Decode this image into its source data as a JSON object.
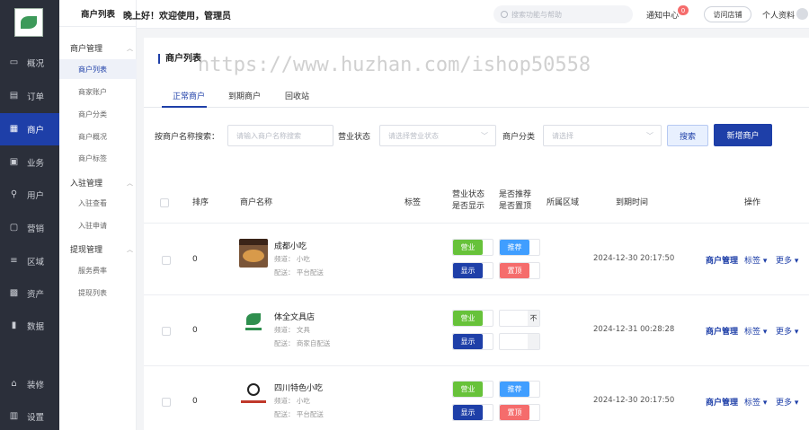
{
  "nav": {
    "items": [
      {
        "label": "概况",
        "icon": "overview-icon"
      },
      {
        "label": "订单",
        "icon": "order-icon"
      },
      {
        "label": "商户",
        "icon": "merchant-icon"
      },
      {
        "label": "业务",
        "icon": "business-icon"
      },
      {
        "label": "用户",
        "icon": "user-icon"
      },
      {
        "label": "营销",
        "icon": "marketing-icon"
      },
      {
        "label": "区域",
        "icon": "region-icon"
      },
      {
        "label": "资产",
        "icon": "asset-icon"
      },
      {
        "label": "数据",
        "icon": "data-icon"
      },
      {
        "label": "装修",
        "icon": "decoration-icon"
      },
      {
        "label": "设置",
        "icon": "settings-icon"
      }
    ]
  },
  "submenu": {
    "title": "商户列表",
    "groups": [
      {
        "label": "商户管理",
        "items": [
          "商户列表",
          "商家账户",
          "商户分类",
          "商户概况",
          "商户标签"
        ]
      },
      {
        "label": "入驻管理",
        "items": [
          "入驻查看",
          "入驻申请"
        ]
      },
      {
        "label": "提现管理",
        "items": [
          "服务费率",
          "提现列表"
        ]
      }
    ]
  },
  "header": {
    "greeting": "晚上好！欢迎使用，管理员",
    "search_placeholder": "搜索功能与帮助",
    "notice": "通知中心",
    "notice_count": "0",
    "visit": "访问店铺",
    "profile": "个人资料"
  },
  "page": {
    "title": "商户列表",
    "watermark": "https://www.huzhan.com/ishop50558",
    "tabs": [
      "正常商户",
      "到期商户",
      "回收站"
    ]
  },
  "filters": {
    "name_label": "按商户名称搜索：",
    "name_placeholder": "请输入商户名称搜索",
    "status_label": "营业状态",
    "status_placeholder": "请选择营业状态",
    "category_label": "商户分类",
    "category_placeholder": "请选择",
    "search_btn": "搜索",
    "add_btn": "新增商户"
  },
  "table": {
    "headers": {
      "sort": "排序",
      "name": "商户名称",
      "tag": "标签",
      "status1": "营业状态",
      "status2": "是否显示",
      "rec1": "是否推荐",
      "rec2": "是否置顶",
      "region": "所属区域",
      "expire": "到期时间",
      "ops": "操作"
    },
    "rows": [
      {
        "sort": "0",
        "name": "成都小吃",
        "channel": "频道：  小吃",
        "delivery": "配送：  平台配送",
        "open": "营业",
        "show": "显示",
        "recommend": "推荐",
        "top": "置顶",
        "rec_on": true,
        "expire": "2024-12-30 20:17:50",
        "thumb": "food-thumbnail"
      },
      {
        "sort": "0",
        "name": "体全文具店",
        "channel": "频道：  文具",
        "delivery": "配送：  商家自配送",
        "open": "营业",
        "show": "显示",
        "recommend": "不",
        "top": "",
        "rec_on": false,
        "expire": "2024-12-31 00:28:28",
        "thumb": "logo-thumbnail"
      },
      {
        "sort": "0",
        "name": "四川特色小吃",
        "channel": "频道：  小吃",
        "delivery": "配送：  平台配送",
        "open": "营业",
        "show": "显示",
        "recommend": "推荐",
        "top": "置顶",
        "rec_on": true,
        "expire": "2024-12-30 20:17:50",
        "thumb": "snack-thumbnail"
      }
    ],
    "actions": {
      "manage": "商户管理",
      "tag": "标签",
      "more": "更多"
    }
  },
  "colors": {
    "primary": "#1e3fa8",
    "nav_bg": "#2b2f3a",
    "green": "#67c23a",
    "red": "#f56c6c",
    "light_blue": "#409eff"
  }
}
